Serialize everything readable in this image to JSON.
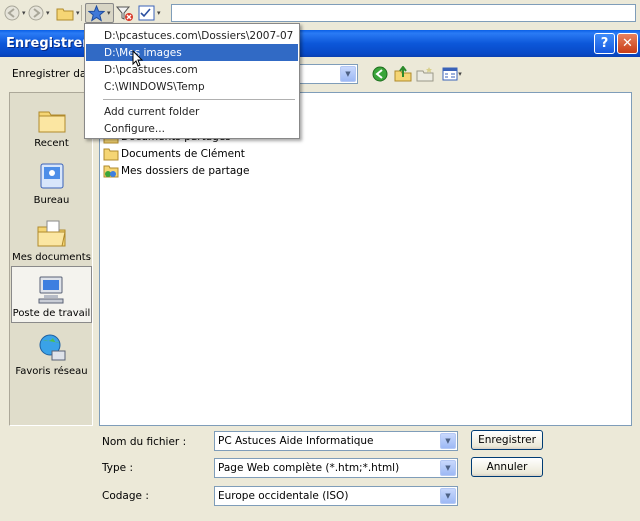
{
  "window": {
    "title": "Enregistrer le",
    "help_glyph": "?",
    "close_glyph": "✕"
  },
  "toolbar": {
    "icons": [
      "back-icon",
      "forward-icon",
      "folder-icon",
      "favorites-star-icon",
      "filter-icon",
      "checklist-icon"
    ],
    "path_value": ""
  },
  "save_in": {
    "label": "Enregistrer dans :",
    "value": ""
  },
  "places": [
    {
      "label": "Recent",
      "icon": "recent-folder-icon",
      "active": false
    },
    {
      "label": "Bureau",
      "icon": "desktop-icon",
      "active": false
    },
    {
      "label": "Mes documents",
      "icon": "my-documents-icon",
      "active": false
    },
    {
      "label": "Poste de travail",
      "icon": "my-computer-icon",
      "active": true
    },
    {
      "label": "Favoris réseau",
      "icon": "network-places-icon",
      "active": false
    }
  ],
  "files": [
    {
      "name": "Documents partagés",
      "icon": "folder-icon"
    },
    {
      "name": "Documents de Clément",
      "icon": "folder-icon"
    },
    {
      "name": "Mes dossiers de partage",
      "icon": "shared-folder-icon"
    }
  ],
  "form": {
    "filename_label": "Nom du fichier :",
    "filename_value": "PC Astuces  Aide Informatique",
    "type_label": "Type :",
    "type_value": "Page Web complète (*.htm;*.html)",
    "encoding_label": "Codage :",
    "encoding_value": "Europe occidentale (ISO)",
    "save_button": "Enregistrer",
    "cancel_button": "Annuler"
  },
  "favorites_menu": {
    "items": [
      {
        "label": "D:\\pcastuces.com\\Dossiers\\2007-07",
        "selected": false
      },
      {
        "label": "D:\\Mes images",
        "selected": true
      },
      {
        "label": "D:\\pcastuces.com",
        "selected": false
      },
      {
        "label": "C:\\WINDOWS\\Temp",
        "selected": false
      }
    ],
    "actions": [
      {
        "label": "Add current folder"
      },
      {
        "label": "Configure..."
      }
    ]
  },
  "colors": {
    "title_bar": "#0c57d9",
    "menu_highlight": "#316ac5",
    "dialog_bg": "#ece9d8"
  }
}
